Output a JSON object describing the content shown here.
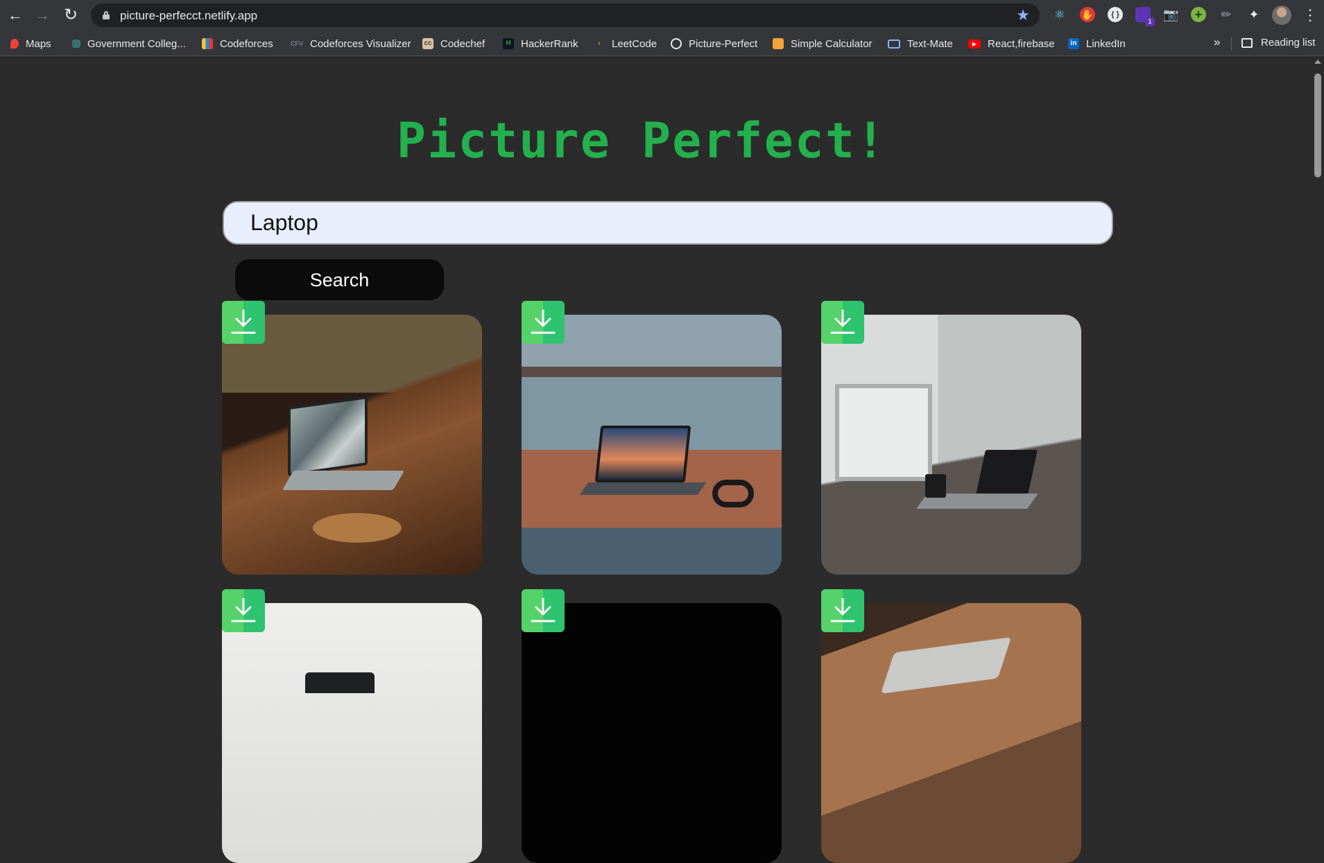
{
  "browser": {
    "url": "picture-perfecct.netlify.app",
    "extension_badge": "1"
  },
  "bookmarks": [
    {
      "label": "Maps",
      "icon": "maps-pin-icon",
      "color": "#ea4335"
    },
    {
      "label": "Government Colleg...",
      "icon": "college-icon",
      "color": "#3c6e71"
    },
    {
      "label": "Codeforces",
      "icon": "codeforces-icon",
      "color": "#1f8acb"
    },
    {
      "label": "Codeforces Visualizer",
      "icon": "cfv-icon",
      "color": "#5f6368"
    },
    {
      "label": "Codechef",
      "icon": "codechef-icon",
      "color": "#8b5e3c"
    },
    {
      "label": "HackerRank",
      "icon": "hackerrank-icon",
      "color": "#111111"
    },
    {
      "label": "LeetCode",
      "icon": "leetcode-icon",
      "color": "#f0a020"
    },
    {
      "label": "Picture-Perfect",
      "icon": "globe-icon",
      "color": "#9aa0a6"
    },
    {
      "label": "Simple Calculator",
      "icon": "calculator-icon",
      "color": "#f2a33a"
    },
    {
      "label": "Text-Mate",
      "icon": "textmate-icon",
      "color": "#8ab4f8"
    },
    {
      "label": "React,firebase",
      "icon": "youtube-icon",
      "color": "#ff0000"
    },
    {
      "label": "LinkedIn",
      "icon": "linkedin-icon",
      "color": "#0a66c2"
    }
  ],
  "bookmarks_more": "»",
  "reading_list": "Reading list",
  "app": {
    "title": "Picture Perfect!",
    "search_value": "Laptop",
    "search_button": "Search"
  },
  "images": [
    {
      "description": "laptop on round side table by leather sofa",
      "dominant": "#5a3a25"
    },
    {
      "description": "laptop on window desk overlooking city",
      "dominant": "#8a5a45"
    },
    {
      "description": "laptop on wooden desk by bright window",
      "dominant": "#cfd2d0"
    },
    {
      "description": "laptop on white background",
      "dominant": "#e6e6e4"
    },
    {
      "description": "dark laptop image",
      "dominant": "#030303"
    },
    {
      "description": "laptop on brown leather surface",
      "dominant": "#8c5c3c"
    }
  ]
}
